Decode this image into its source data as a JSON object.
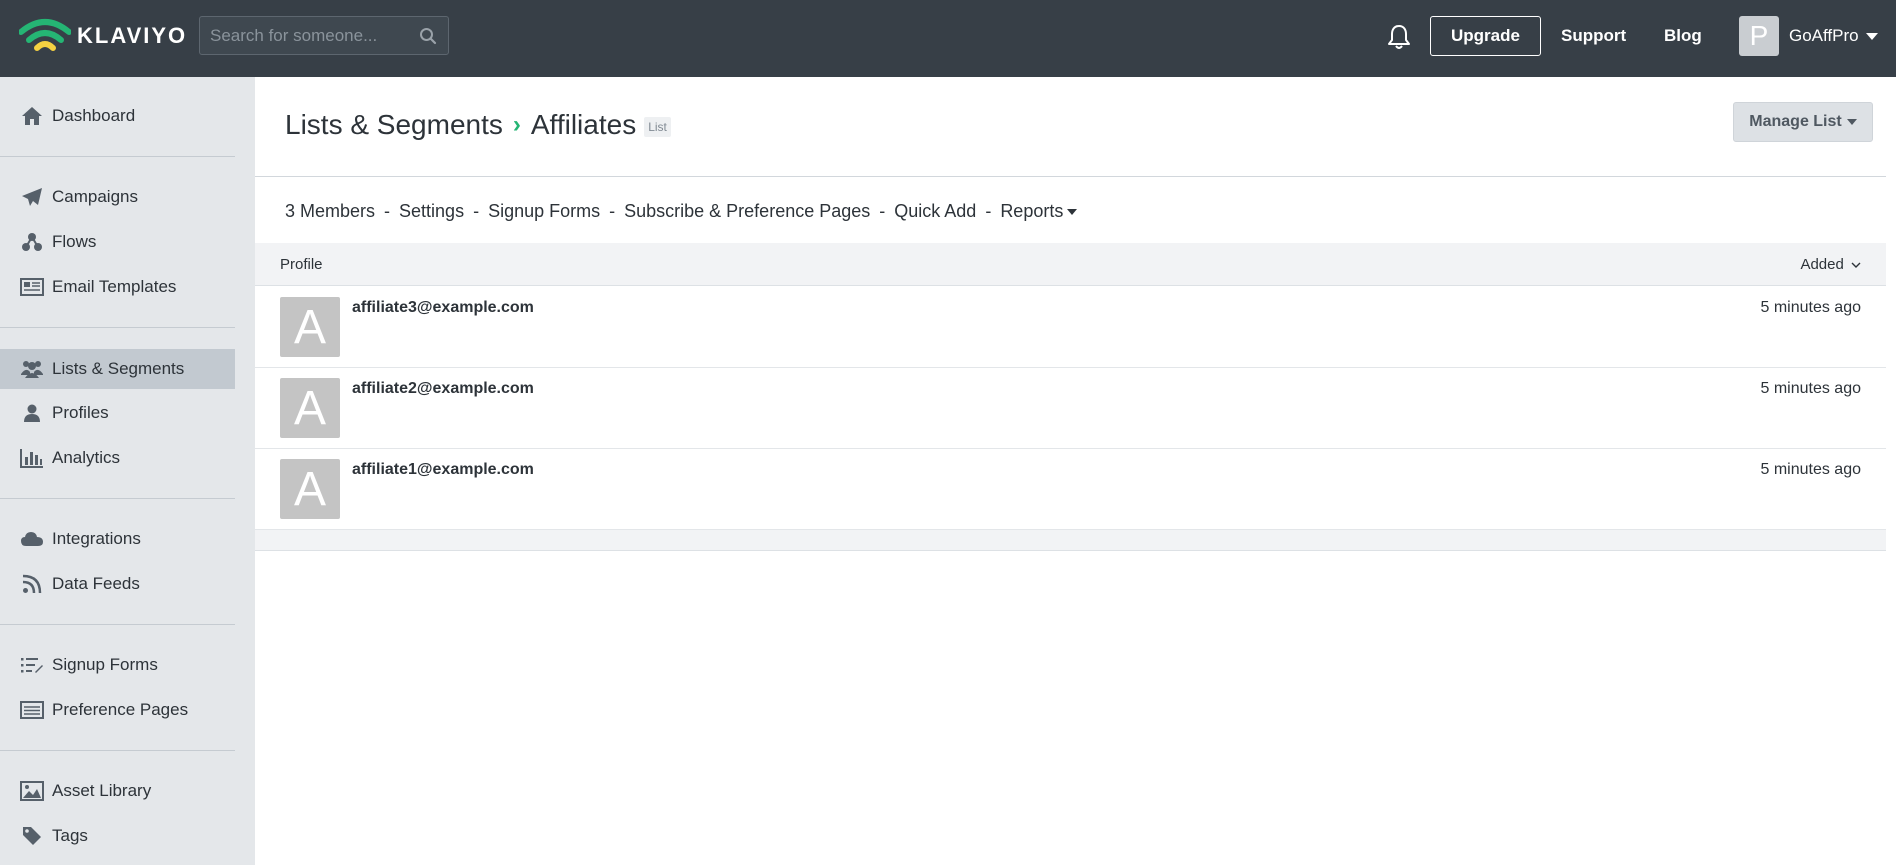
{
  "topbar": {
    "logo_text": "KLAVIYO",
    "search_placeholder": "Search for someone...",
    "upgrade_label": "Upgrade",
    "support_label": "Support",
    "blog_label": "Blog",
    "avatar_letter": "P",
    "account_name": "GoAffPro"
  },
  "sidebar": {
    "items": [
      {
        "label": "Dashboard",
        "icon": "home-icon"
      },
      {
        "label": "Campaigns",
        "icon": "paper-plane-icon"
      },
      {
        "label": "Flows",
        "icon": "flows-icon"
      },
      {
        "label": "Email Templates",
        "icon": "newspaper-icon"
      },
      {
        "label": "Lists & Segments",
        "icon": "users-icon",
        "active": true
      },
      {
        "label": "Profiles",
        "icon": "user-icon"
      },
      {
        "label": "Analytics",
        "icon": "bar-chart-icon"
      },
      {
        "label": "Integrations",
        "icon": "cloud-icon"
      },
      {
        "label": "Data Feeds",
        "icon": "rss-icon"
      },
      {
        "label": "Signup Forms",
        "icon": "form-list-icon"
      },
      {
        "label": "Preference Pages",
        "icon": "list-alt-icon"
      },
      {
        "label": "Asset Library",
        "icon": "image-icon"
      },
      {
        "label": "Tags",
        "icon": "tag-icon"
      }
    ]
  },
  "main": {
    "breadcrumb_parent": "Lists & Segments",
    "breadcrumb_current": "Affiliates",
    "breadcrumb_tag": "List",
    "manage_list_label": "Manage List",
    "subnav": {
      "members": "3 Members",
      "settings": "Settings",
      "signup_forms": "Signup Forms",
      "subscribe_pages": "Subscribe & Preference Pages",
      "quick_add": "Quick Add",
      "reports": "Reports",
      "separator": "-"
    },
    "table": {
      "col_profile": "Profile",
      "col_added": "Added",
      "rows": [
        {
          "avatar": "A",
          "email": "affiliate3@example.com",
          "added": "5 minutes ago"
        },
        {
          "avatar": "A",
          "email": "affiliate2@example.com",
          "added": "5 minutes ago"
        },
        {
          "avatar": "A",
          "email": "affiliate1@example.com",
          "added": "5 minutes ago"
        }
      ]
    }
  },
  "colors": {
    "topbar_bg": "#373f47",
    "sidebar_bg": "#e4e7ea",
    "sidebar_active": "#c2c9d0",
    "accent_green": "#25b574"
  }
}
